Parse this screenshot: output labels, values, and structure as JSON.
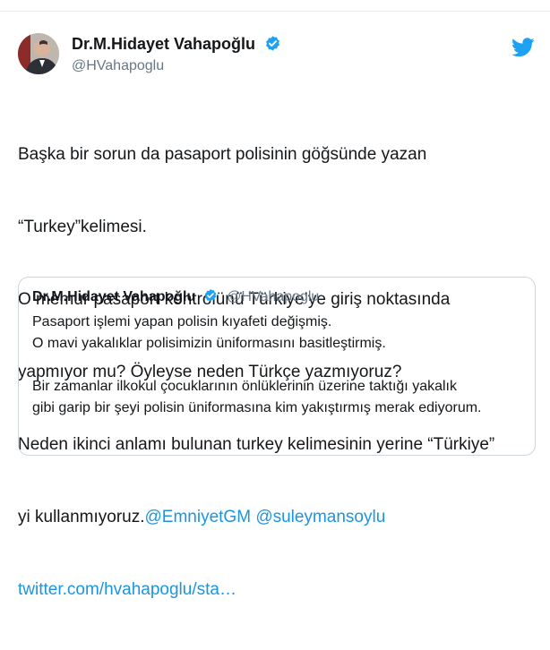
{
  "author": {
    "name": "Dr.M.Hidayet Vahapoğlu",
    "handle": "@HVahapoglu"
  },
  "tweet": {
    "lines": [
      "Başka bir sorun da pasaport polisinin göğsünde yazan",
      "“Turkey”kelimesi.",
      "O memur pasaport kontrolünü Türkiye’ye giriş noktasında",
      "yapmıyor mu? Öyleyse neden Türkçe yazmıyoruz?",
      "Neden ikinci anlamı bulunan turkey kelimesinin yerine “Türkiye”"
    ],
    "last_line_text": "yi kullanmıyoruz.",
    "mention_1": "@EmniyetGM",
    "mention_2": "@suleymansoylu",
    "link": "twitter.com/hvahapoglu/sta…"
  },
  "quoted": {
    "name": "Dr.M.Hidayet Vahapoğlu",
    "handle": "@HVahapoglu",
    "lines": [
      "Pasaport işlemi yapan polisin kıyafeti değişmiş.",
      "O mavi yakalıklar polisimizin üniformasını basitleştirmiş.",
      "",
      "Bir zamanlar ilkokul çocuklarının önlüklerinin üzerine taktığı yakalık",
      "gibi garip bir şeyi polisin üniformasına kim yakıştırmış merak ediyorum."
    ]
  },
  "icons": {
    "verified": "verified-badge-icon",
    "logo": "twitter-bird-icon"
  },
  "colors": {
    "link": "#1b95e0",
    "verified": "#1da1f2",
    "handle": "#657786",
    "border": "#ccd6dd"
  }
}
